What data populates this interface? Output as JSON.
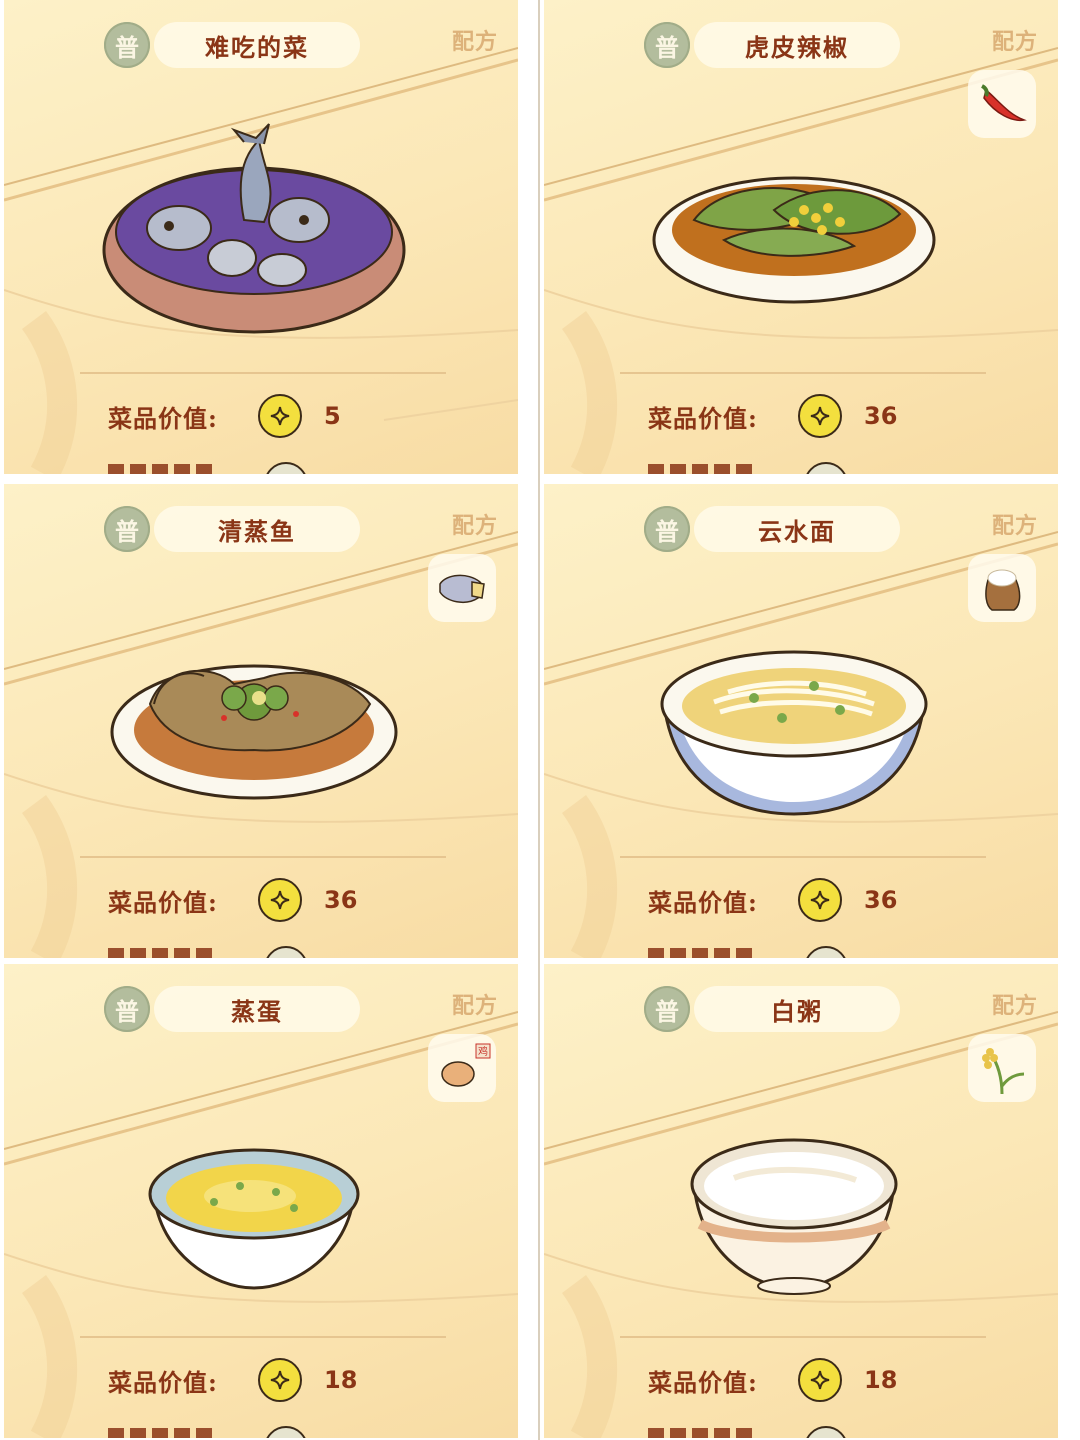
{
  "cards": [
    {
      "grade": "普",
      "name": "难吃的菜",
      "recipe_label": "配方",
      "value_label": "菜品价值:",
      "value": "5",
      "ingredient_icon": "none",
      "dish_icon": "purple-fish-soup-icon"
    },
    {
      "grade": "普",
      "name": "虎皮辣椒",
      "recipe_label": "配方",
      "value_label": "菜品价值:",
      "value": "36",
      "ingredient_icon": "chili-pepper-icon",
      "dish_icon": "tiger-skin-pepper-icon"
    },
    {
      "grade": "普",
      "name": "清蒸鱼",
      "recipe_label": "配方",
      "value_label": "菜品价值:",
      "value": "36",
      "ingredient_icon": "fish-icon",
      "dish_icon": "steamed-fish-icon"
    },
    {
      "grade": "普",
      "name": "云水面",
      "recipe_label": "配方",
      "value_label": "菜品价值:",
      "value": "36",
      "ingredient_icon": "flour-sack-icon",
      "dish_icon": "noodle-bowl-icon"
    },
    {
      "grade": "普",
      "name": "蒸蛋",
      "recipe_label": "配方",
      "value_label": "菜品价值:",
      "value": "18",
      "ingredient_icon": "egg-icon",
      "ingredient_tag": "鸡",
      "dish_icon": "steamed-egg-icon"
    },
    {
      "grade": "普",
      "name": "白粥",
      "recipe_label": "配方",
      "value_label": "菜品价值:",
      "value": "18",
      "ingredient_icon": "rice-stalk-icon",
      "dish_icon": "rice-porridge-icon"
    }
  ],
  "colors": {
    "title_text": "#8a3516",
    "recipe_text": "#ddb27a",
    "badge": "#b3bd9d",
    "coin": "#f3df3e",
    "card_bg": "#fbe7b6"
  }
}
